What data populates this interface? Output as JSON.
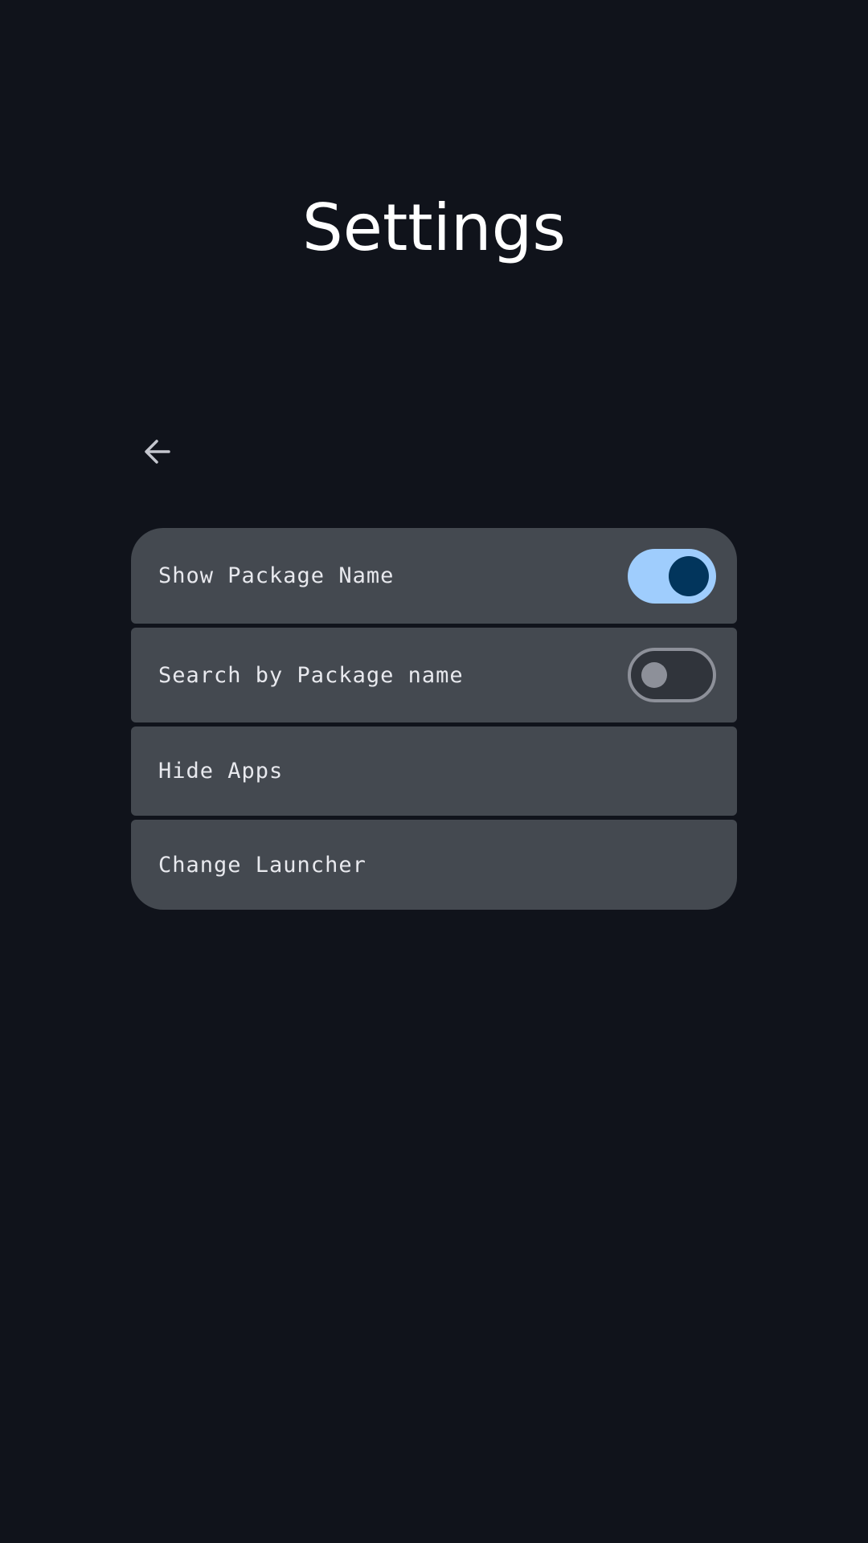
{
  "header": {
    "title": "Settings"
  },
  "nav": {
    "back_icon": "arrow-back-icon"
  },
  "settings": {
    "items": [
      {
        "label": "Show Package Name",
        "toggle": true,
        "enabled": true
      },
      {
        "label": "Search by Package name",
        "toggle": true,
        "enabled": false
      },
      {
        "label": "Hide Apps"
      },
      {
        "label": "Change Launcher"
      }
    ]
  },
  "colors": {
    "background": "#10131b",
    "card": "#444950",
    "toggle_on_track": "#9fcdfd",
    "toggle_on_thumb": "#02355c",
    "toggle_off_outline": "#8d9099"
  }
}
